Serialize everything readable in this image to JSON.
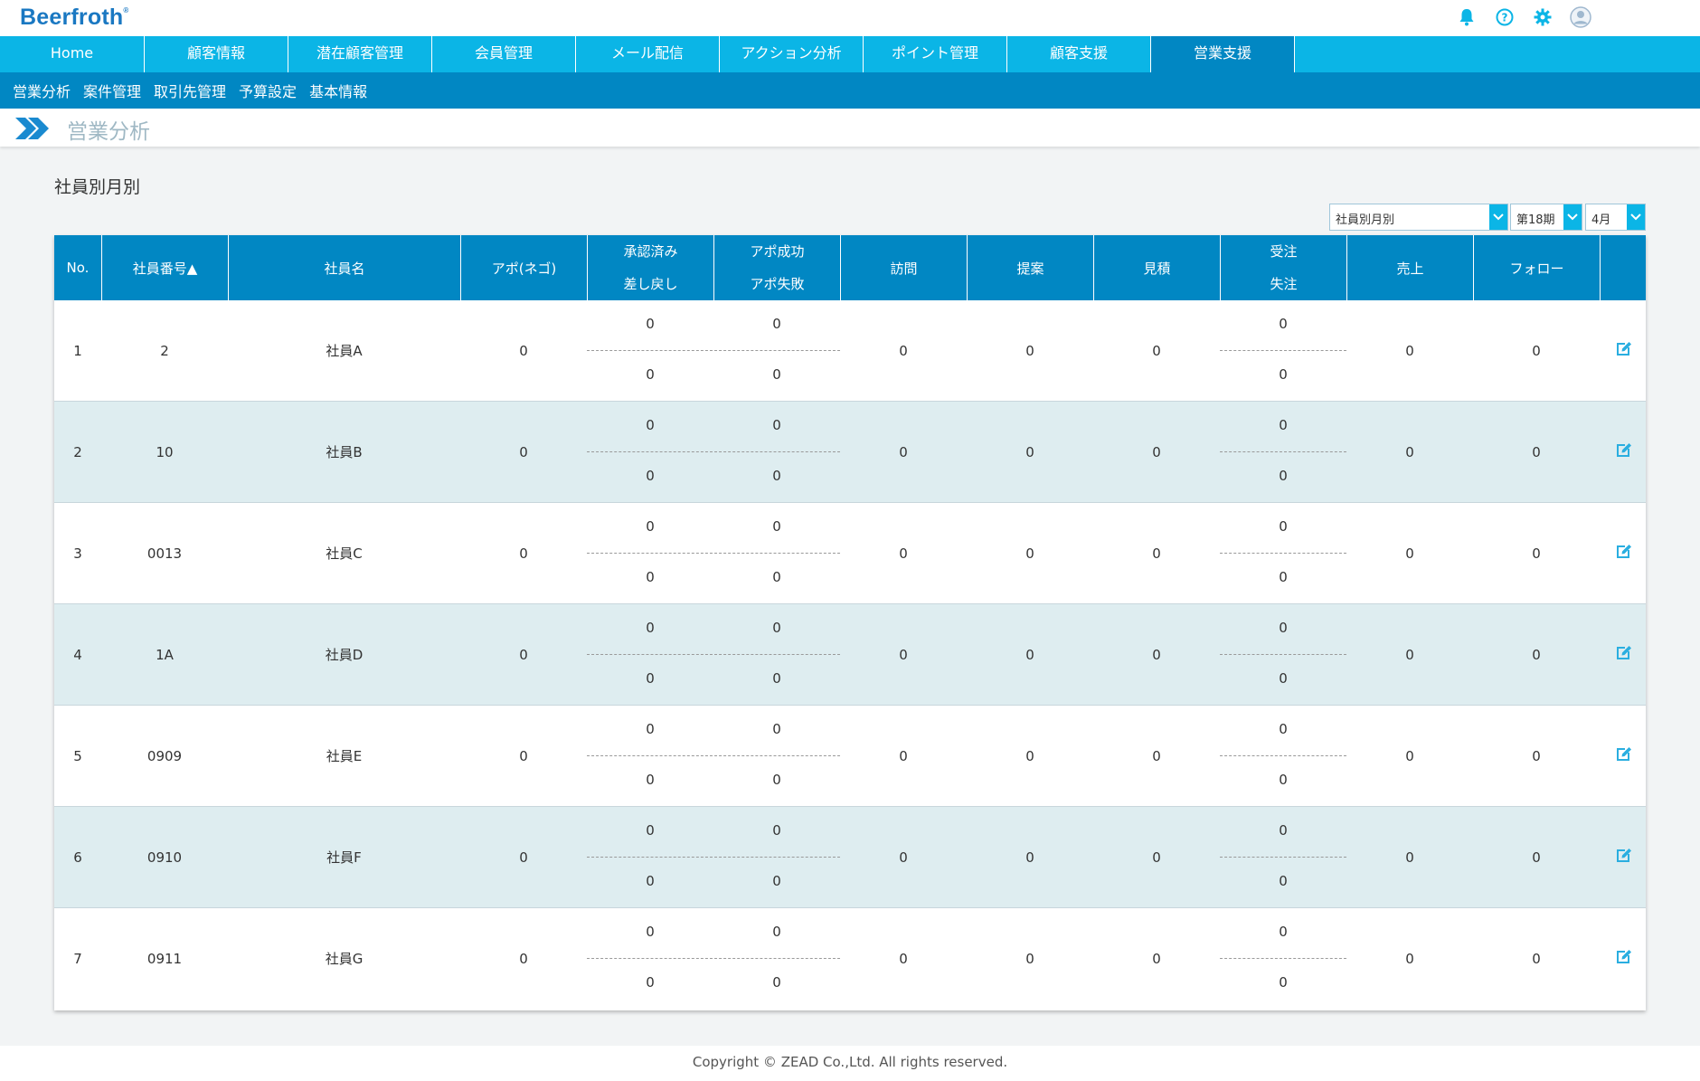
{
  "app": {
    "logo_text": "Beerfroth",
    "logo_mark": "®"
  },
  "top_icons": [
    {
      "name": "bell-icon"
    },
    {
      "name": "help-icon"
    },
    {
      "name": "gear-icon"
    },
    {
      "name": "user-avatar-icon"
    }
  ],
  "main_nav": {
    "items": [
      "Home",
      "顧客情報",
      "潜在顧客管理",
      "会員管理",
      "メール配信",
      "アクション分析",
      "ポイント管理",
      "顧客支援",
      "営業支援"
    ],
    "active_index": 8
  },
  "sub_nav": {
    "items": [
      "営業分析",
      "案件管理",
      "取引先管理",
      "予算設定",
      "基本情報"
    ]
  },
  "page": {
    "title": "営業分析",
    "section_title": "社員別月別"
  },
  "filters": {
    "view": "社員別月別",
    "period": "第18期",
    "month": "4月"
  },
  "table": {
    "headers": {
      "no": "No.",
      "employee_no": "社員番号▲",
      "employee_name": "社員名",
      "apo": "アポ(ネゴ)",
      "approved_top": "承認済み",
      "approved_bottom": "差し戻し",
      "apo_success_top": "アポ成功",
      "apo_success_bottom": "アポ失敗",
      "visit": "訪問",
      "proposal": "提案",
      "estimate": "見積",
      "order_top": "受注",
      "order_bottom": "失注",
      "sales": "売上",
      "follow": "フォロー"
    },
    "rows": [
      {
        "no": "1",
        "employee_no": "2",
        "name": "社員A",
        "apo": "0",
        "approved": "0",
        "returned": "0",
        "apo_success": "0",
        "apo_fail": "0",
        "visit": "0",
        "proposal": "0",
        "estimate": "0",
        "order": "0",
        "lost": "0",
        "sales": "0",
        "follow": "0"
      },
      {
        "no": "2",
        "employee_no": "10",
        "name": "社員B",
        "apo": "0",
        "approved": "0",
        "returned": "0",
        "apo_success": "0",
        "apo_fail": "0",
        "visit": "0",
        "proposal": "0",
        "estimate": "0",
        "order": "0",
        "lost": "0",
        "sales": "0",
        "follow": "0"
      },
      {
        "no": "3",
        "employee_no": "0013",
        "name": "社員C",
        "apo": "0",
        "approved": "0",
        "returned": "0",
        "apo_success": "0",
        "apo_fail": "0",
        "visit": "0",
        "proposal": "0",
        "estimate": "0",
        "order": "0",
        "lost": "0",
        "sales": "0",
        "follow": "0"
      },
      {
        "no": "4",
        "employee_no": "1A",
        "name": "社員D",
        "apo": "0",
        "approved": "0",
        "returned": "0",
        "apo_success": "0",
        "apo_fail": "0",
        "visit": "0",
        "proposal": "0",
        "estimate": "0",
        "order": "0",
        "lost": "0",
        "sales": "0",
        "follow": "0"
      },
      {
        "no": "5",
        "employee_no": "0909",
        "name": "社員E",
        "apo": "0",
        "approved": "0",
        "returned": "0",
        "apo_success": "0",
        "apo_fail": "0",
        "visit": "0",
        "proposal": "0",
        "estimate": "0",
        "order": "0",
        "lost": "0",
        "sales": "0",
        "follow": "0"
      },
      {
        "no": "6",
        "employee_no": "0910",
        "name": "社員F",
        "apo": "0",
        "approved": "0",
        "returned": "0",
        "apo_success": "0",
        "apo_fail": "0",
        "visit": "0",
        "proposal": "0",
        "estimate": "0",
        "order": "0",
        "lost": "0",
        "sales": "0",
        "follow": "0"
      },
      {
        "no": "7",
        "employee_no": "0911",
        "name": "社員G",
        "apo": "0",
        "approved": "0",
        "returned": "0",
        "apo_success": "0",
        "apo_fail": "0",
        "visit": "0",
        "proposal": "0",
        "estimate": "0",
        "order": "0",
        "lost": "0",
        "sales": "0",
        "follow": "0"
      }
    ]
  },
  "footer": {
    "copyright": "Copyright © ZEAD Co.,Ltd. All rights reserved."
  },
  "colors": {
    "nav": "#0bb5e6",
    "nav_active": "#0187c3",
    "header": "#0187c3",
    "row_alt": "#deedf0",
    "logo": "#1a78c2"
  }
}
